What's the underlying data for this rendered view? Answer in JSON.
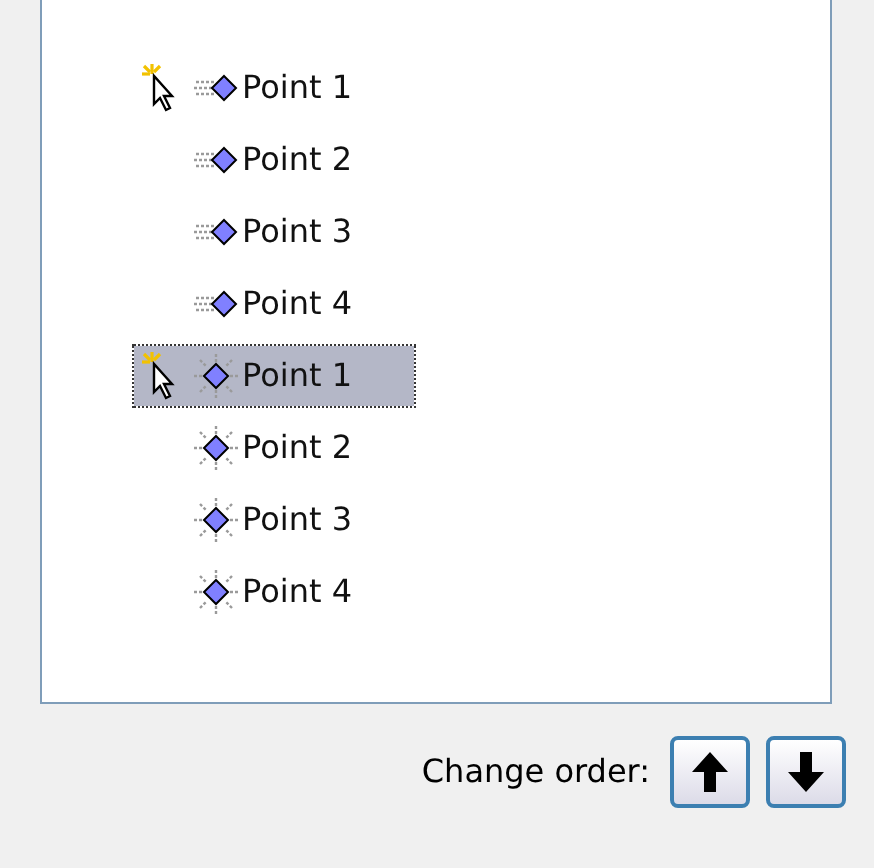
{
  "animation_list": {
    "items": [
      {
        "label": "Point 1",
        "kind": "fly-in",
        "on_click": true,
        "selected": false
      },
      {
        "label": "Point 2",
        "kind": "fly-in",
        "on_click": false,
        "selected": false
      },
      {
        "label": "Point 3",
        "kind": "fly-in",
        "on_click": false,
        "selected": false
      },
      {
        "label": "Point 4",
        "kind": "fly-in",
        "on_click": false,
        "selected": false
      },
      {
        "label": "Point 1",
        "kind": "sparkle",
        "on_click": true,
        "selected": true
      },
      {
        "label": "Point 2",
        "kind": "sparkle",
        "on_click": false,
        "selected": false
      },
      {
        "label": "Point 3",
        "kind": "sparkle",
        "on_click": false,
        "selected": false
      },
      {
        "label": "Point 4",
        "kind": "sparkle",
        "on_click": false,
        "selected": false
      }
    ]
  },
  "reorder": {
    "label": "Change order:"
  }
}
